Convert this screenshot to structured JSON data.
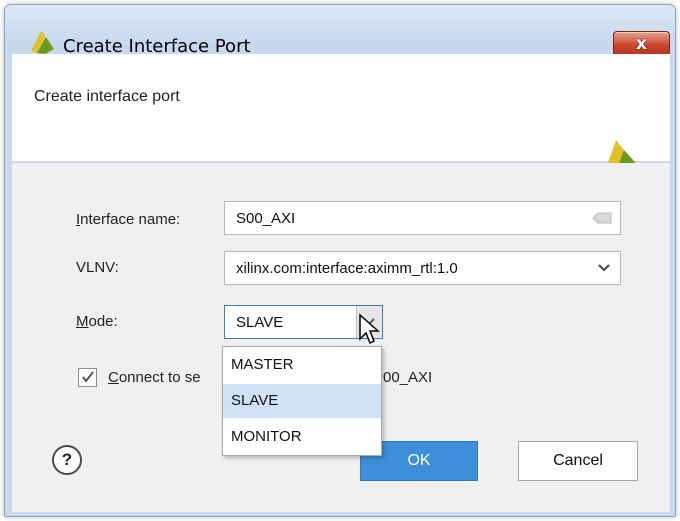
{
  "window": {
    "title": "Create Interface Port",
    "close_label": "x"
  },
  "header": {
    "description": "Create interface port"
  },
  "form": {
    "interface_name": {
      "label_mnemonic": "I",
      "label_rest": "nterface name:",
      "value": "S00_AXI"
    },
    "vlnv": {
      "label": "VLNV:",
      "value": "xilinx.com:interface:aximm_rtl:1.0"
    },
    "mode": {
      "label_mnemonic": "M",
      "label_rest": "ode:",
      "value": "SLAVE"
    },
    "connect": {
      "checked": true,
      "label_mnemonic": "C",
      "label_visible_left": "onnect to se",
      "label_visible_right": "00_AXI"
    }
  },
  "mode_dropdown": {
    "options": [
      "MASTER",
      "SLAVE",
      "MONITOR"
    ],
    "selected": "SLAVE"
  },
  "buttons": {
    "help": "?",
    "ok": "OK",
    "cancel": "Cancel"
  },
  "colors": {
    "accent": "#3d8fdb",
    "selection": "#cfe2f5",
    "logo_green": "#6a9a1f",
    "logo_yellow": "#e0c12a"
  }
}
